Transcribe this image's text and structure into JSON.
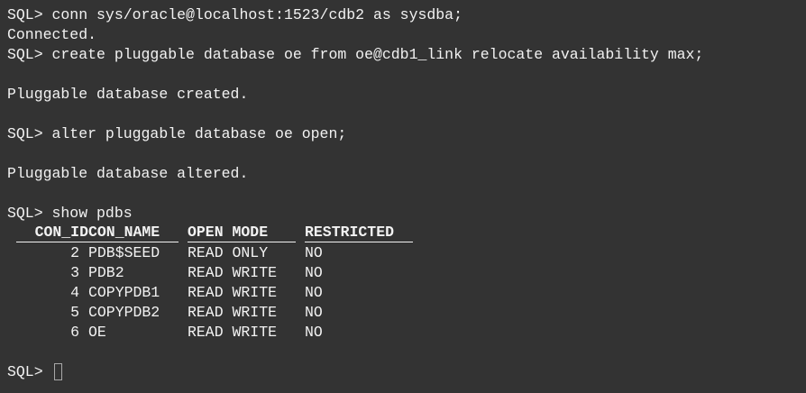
{
  "terminal": {
    "lines": [
      "SQL> conn sys/oracle@localhost:1523/cdb2 as sysdba;",
      "Connected.",
      "SQL> create pluggable database oe from oe@cdb1_link relocate availability max;",
      "",
      "Pluggable database created.",
      "",
      "SQL> alter pluggable database oe open;",
      "",
      "Pluggable database altered.",
      "",
      "SQL> show pdbs"
    ],
    "table": {
      "headers": {
        "con_id": "CON_ID",
        "con_name": "CON_NAME",
        "open_mode": "OPEN MODE",
        "restricted": "RESTRICTED"
      },
      "rows": [
        {
          "con_id": "2",
          "con_name": "PDB$SEED",
          "open_mode": "READ ONLY",
          "restricted": "NO"
        },
        {
          "con_id": "3",
          "con_name": "PDB2",
          "open_mode": "READ WRITE",
          "restricted": "NO"
        },
        {
          "con_id": "4",
          "con_name": "COPYPDB1",
          "open_mode": "READ WRITE",
          "restricted": "NO"
        },
        {
          "con_id": "5",
          "con_name": "COPYPDB2",
          "open_mode": "READ WRITE",
          "restricted": "NO"
        },
        {
          "con_id": "6",
          "con_name": "OE",
          "open_mode": "READ WRITE",
          "restricted": "NO"
        }
      ]
    },
    "prompt": "SQL> ",
    "colors": {
      "background": "#333333",
      "foreground": "#f2f2f2",
      "cursor_outline": "#a8a8a8"
    }
  }
}
